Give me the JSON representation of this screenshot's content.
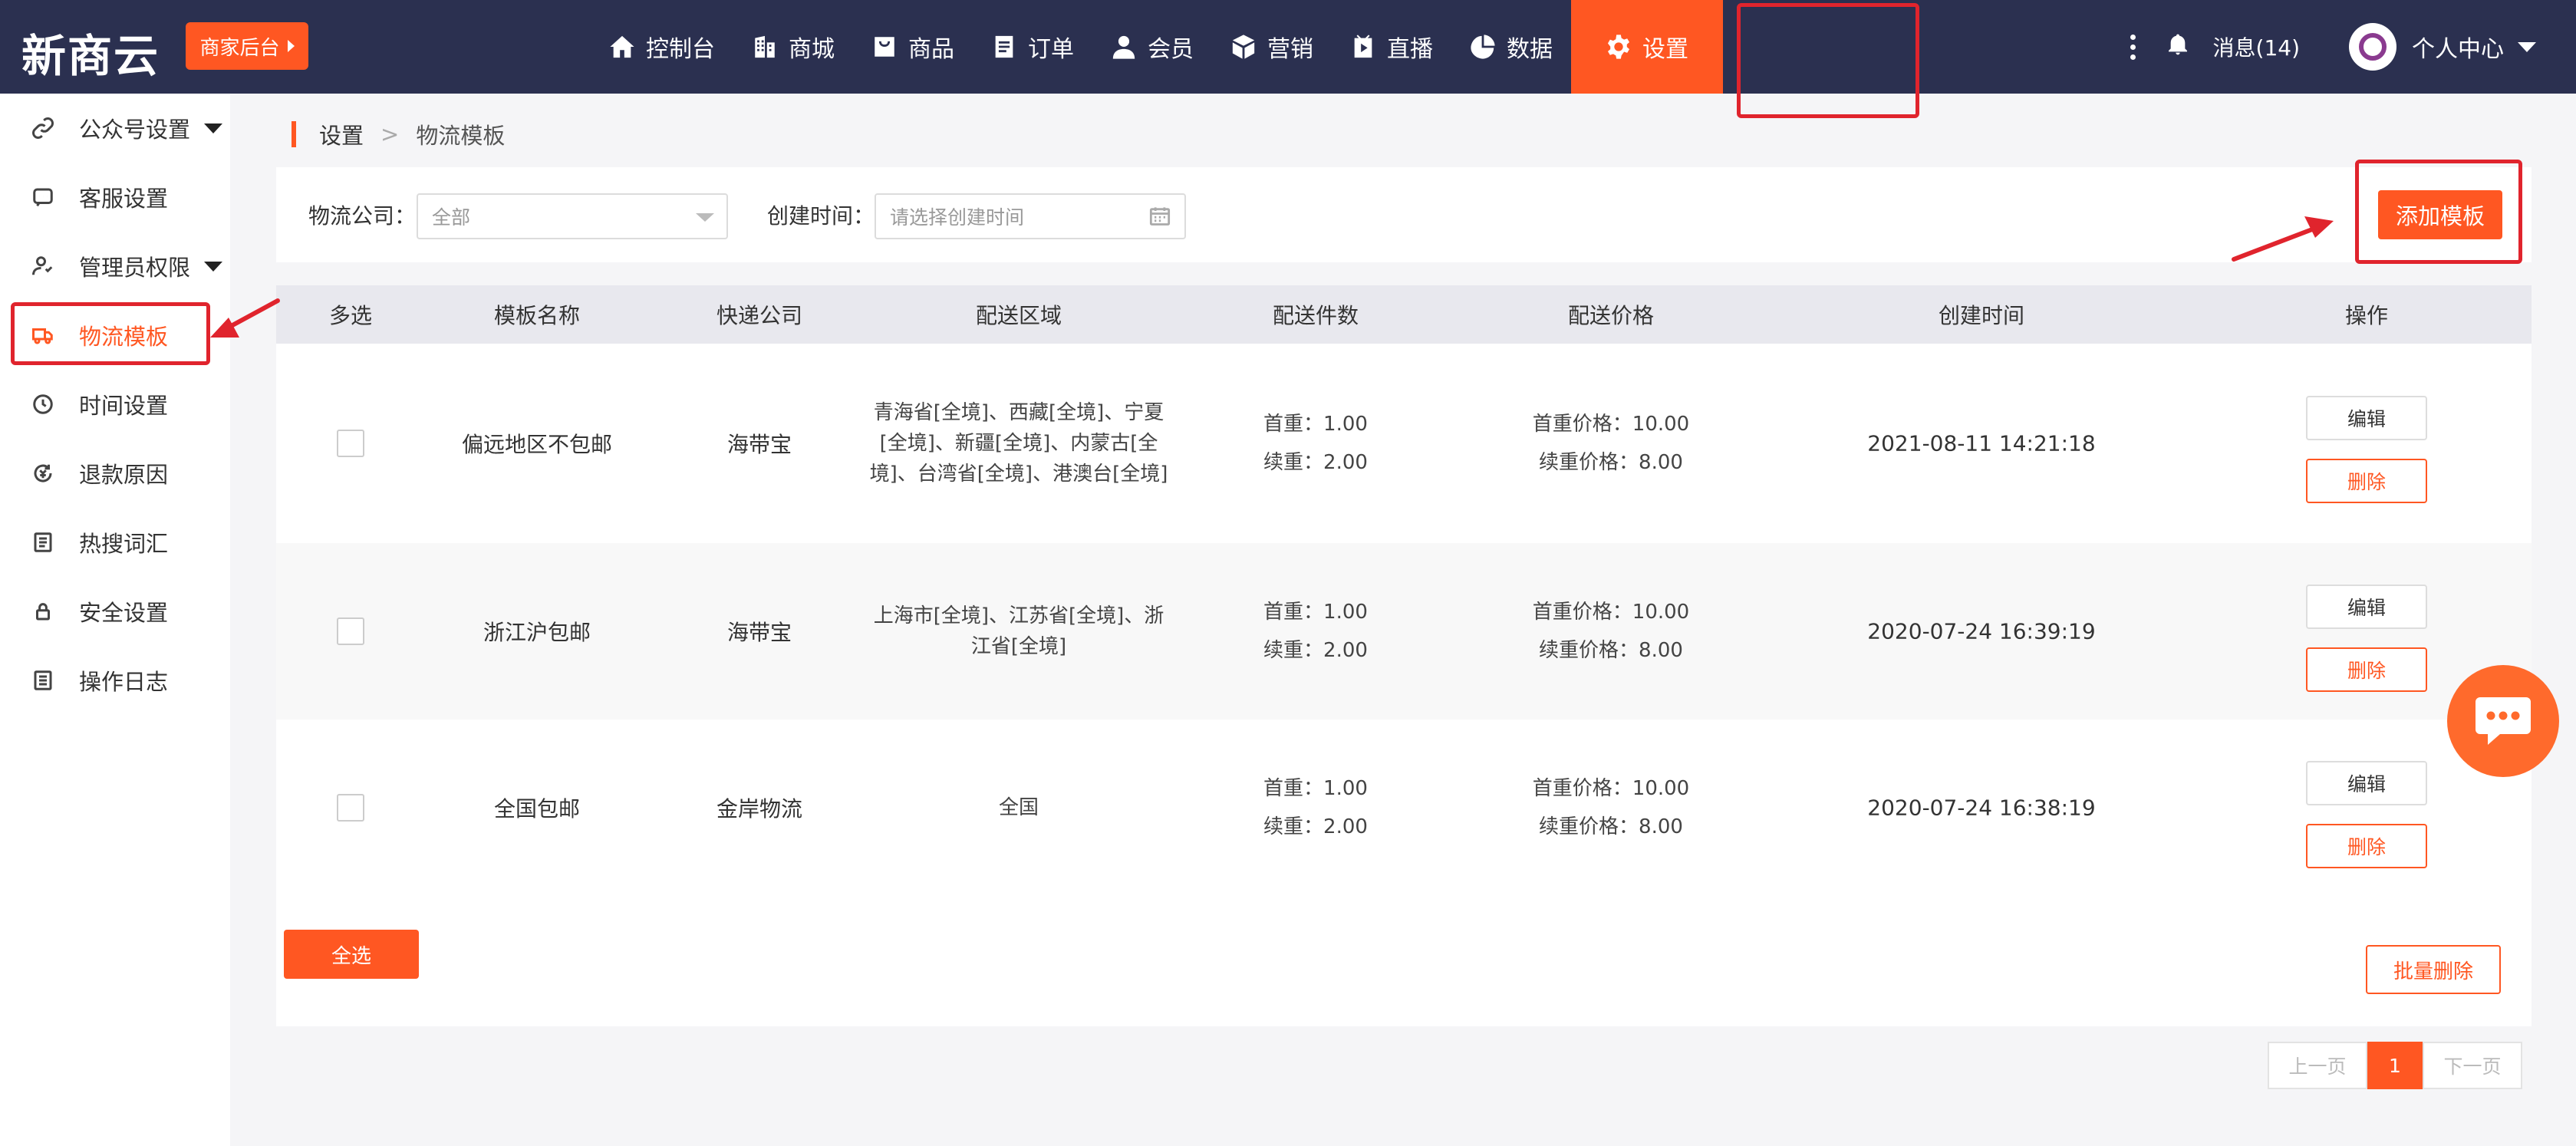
{
  "brand": {
    "logo": "新商云",
    "badge": "商家后台"
  },
  "nav": [
    {
      "label": "控制台",
      "icon": "home-icon"
    },
    {
      "label": "商城",
      "icon": "building-icon"
    },
    {
      "label": "商品",
      "icon": "bag-icon"
    },
    {
      "label": "订单",
      "icon": "order-icon"
    },
    {
      "label": "会员",
      "icon": "user-icon"
    },
    {
      "label": "营销",
      "icon": "box-icon"
    },
    {
      "label": "直播",
      "icon": "live-icon"
    },
    {
      "label": "数据",
      "icon": "pie-icon"
    },
    {
      "label": "设置",
      "icon": "gear-icon",
      "active": true
    }
  ],
  "header": {
    "messages": "消息(14)",
    "user_center": "个人中心"
  },
  "sidebar": [
    {
      "label": "公众号设置",
      "icon": "link-icon",
      "dropdown": true
    },
    {
      "label": "客服设置",
      "icon": "chat-icon"
    },
    {
      "label": "管理员权限",
      "icon": "admin-icon",
      "dropdown": true
    },
    {
      "label": "物流模板",
      "icon": "truck-icon",
      "active": true
    },
    {
      "label": "时间设置",
      "icon": "clock-icon"
    },
    {
      "label": "退款原因",
      "icon": "refund-icon"
    },
    {
      "label": "热搜词汇",
      "icon": "list-icon"
    },
    {
      "label": "安全设置",
      "icon": "lock-icon"
    },
    {
      "label": "操作日志",
      "icon": "log-icon"
    }
  ],
  "breadcrumb": {
    "parent": "设置",
    "separator": ">",
    "current": "物流模板"
  },
  "filters": {
    "company_label": "物流公司：",
    "company_value": "全部",
    "time_label": "创建时间：",
    "time_placeholder": "请选择创建时间"
  },
  "add_button": "添加模板",
  "table": {
    "columns": [
      "多选",
      "模板名称",
      "快递公司",
      "配送区域",
      "配送件数",
      "配送价格",
      "创建时间",
      "操作"
    ],
    "rows": [
      {
        "name": "偏远地区不包邮",
        "company": "海带宝",
        "region": "青海省[全境]、西藏[全境]、宁夏[全境]、新疆[全境]、内蒙古[全境]、台湾省[全境]、港澳台[全境]",
        "first_weight": "首重：1.00",
        "extra_weight": "续重：2.00",
        "first_price": "首重价格：10.00",
        "extra_price": "续重价格：8.00",
        "created": "2021-08-11 14:21:18"
      },
      {
        "name": "浙江沪包邮",
        "company": "海带宝",
        "region": "上海市[全境]、江苏省[全境]、浙江省[全境]",
        "first_weight": "首重：1.00",
        "extra_weight": "续重：2.00",
        "first_price": "首重价格：10.00",
        "extra_price": "续重价格：8.00",
        "created": "2020-07-24 16:39:19"
      },
      {
        "name": "全国包邮",
        "company": "金岸物流",
        "region": "全国",
        "first_weight": "首重：1.00",
        "extra_weight": "续重：2.00",
        "first_price": "首重价格：10.00",
        "extra_price": "续重价格：8.00",
        "created": "2020-07-24 16:38:19"
      }
    ],
    "edit_label": "编辑",
    "delete_label": "删除"
  },
  "select_all": "全选",
  "batch_delete": "批量删除",
  "pagination": {
    "prev": "上一页",
    "current": "1",
    "next": "下一页"
  },
  "colors": {
    "accent": "#ff5722",
    "nav_bg": "#2b3050",
    "annotation": "#e0242d"
  }
}
